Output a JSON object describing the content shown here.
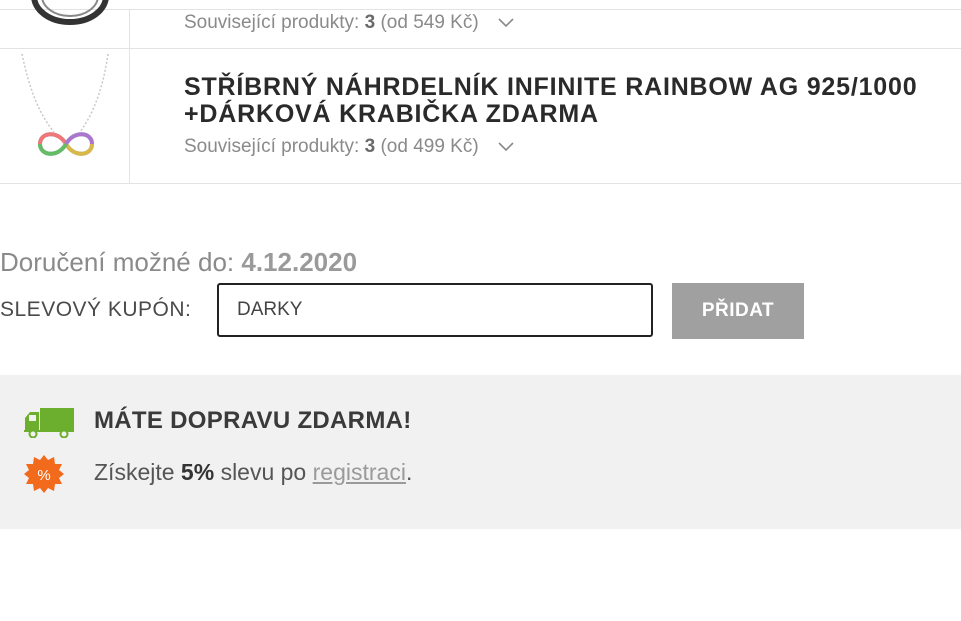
{
  "products": [
    {
      "title": "",
      "related_label": "Související produkty:",
      "related_count": "3",
      "related_price": "(od 549 Kč)"
    },
    {
      "title": "STŘÍBRNÝ NÁHRDELNÍK INFINITE RAINBOW AG 925/1000 +DÁRKOVÁ KRABIČKA ZDARMA",
      "related_label": "Související produkty:",
      "related_count": "3",
      "related_price": "(od 499 Kč)"
    }
  ],
  "delivery": {
    "label": "Doručení možné do:",
    "date": "4.12.2020"
  },
  "coupon": {
    "label": "SLEVOVÝ KUPÓN:",
    "value": "DARKY",
    "button_label": "PŘIDAT"
  },
  "info": {
    "free_shipping": "MÁTE DOPRAVU ZDARMA!",
    "discount_prefix": "Získejte",
    "discount_value": "5%",
    "discount_middle": "slevu po",
    "discount_link": "registraci",
    "discount_suffix": ".",
    "percent_symbol": "%"
  },
  "colors": {
    "truck_icon": "#6cae2d",
    "badge_icon": "#f26b1d",
    "button": "#a0a0a0"
  }
}
